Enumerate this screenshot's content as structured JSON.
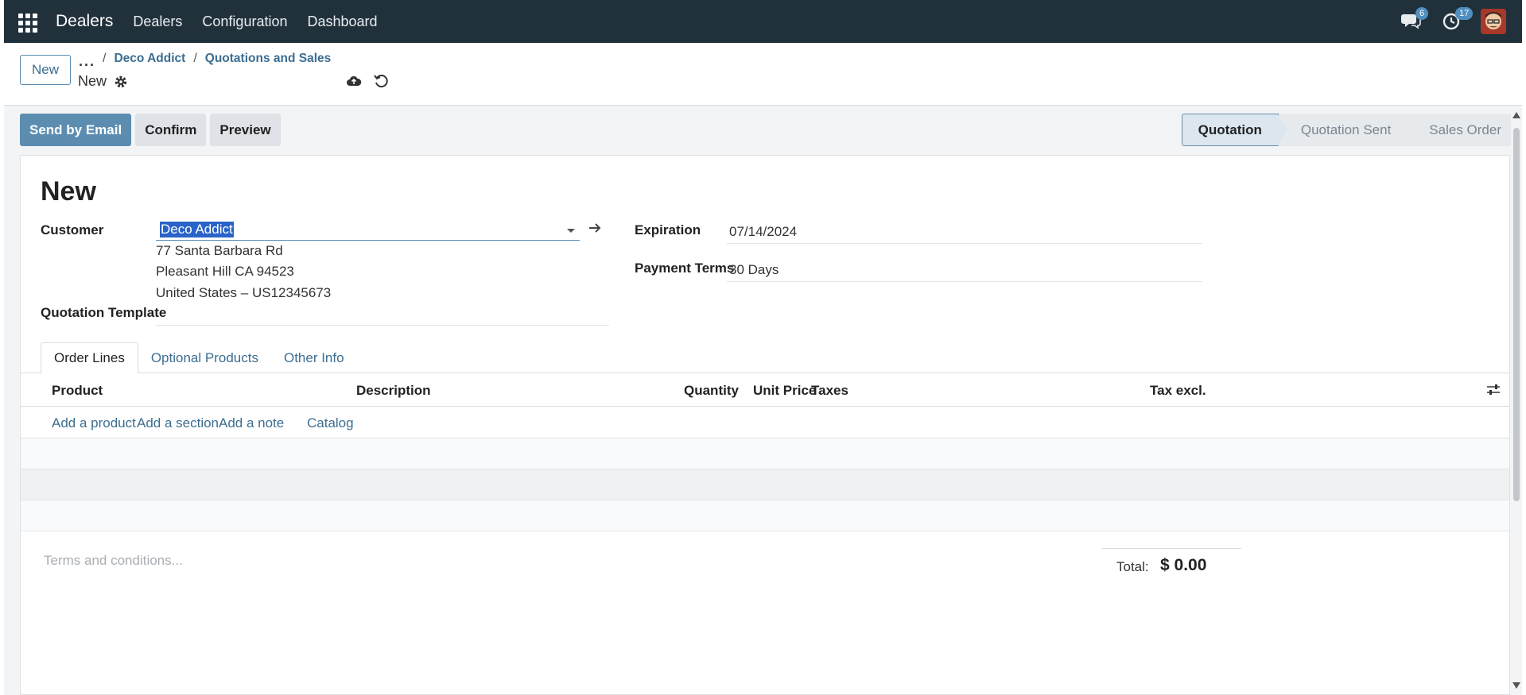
{
  "navbar": {
    "app_name": "Dealers",
    "menu": [
      "Dealers",
      "Configuration",
      "Dashboard"
    ],
    "messages_count": "6",
    "activities_count": "17",
    "bg_color": "#21313c"
  },
  "control": {
    "new_label": "New",
    "breadcrumb": [
      "Deco Addict",
      "Quotations and Sales"
    ],
    "record_name": "New"
  },
  "actions": {
    "send_email": "Send by Email",
    "confirm": "Confirm",
    "preview": "Preview"
  },
  "stages": [
    "Quotation",
    "Quotation Sent",
    "Sales Order"
  ],
  "form": {
    "title": "New",
    "customer_label": "Customer",
    "customer_value": "Deco Addict",
    "address_line1": "77 Santa Barbara Rd",
    "address_line2": "Pleasant Hill CA 94523",
    "address_line3": "United States – US12345673",
    "template_label": "Quotation Template",
    "expiration_label": "Expiration",
    "expiration_value": "07/14/2024",
    "payment_label": "Payment Terms",
    "payment_value": "30 Days"
  },
  "tabs": [
    "Order Lines",
    "Optional Products",
    "Other Info"
  ],
  "table": {
    "columns": [
      "Product",
      "Description",
      "Quantity",
      "Unit Price",
      "Taxes",
      "Tax excl."
    ],
    "add_links": [
      "Add a product",
      "Add a section",
      "Add a note",
      "Catalog"
    ]
  },
  "footer": {
    "terms_placeholder": "Terms and conditions...",
    "total_label": "Total:",
    "total_value": "$ 0.00"
  },
  "colors": {
    "primary": "#5c8db0",
    "link": "#3c6e91"
  }
}
